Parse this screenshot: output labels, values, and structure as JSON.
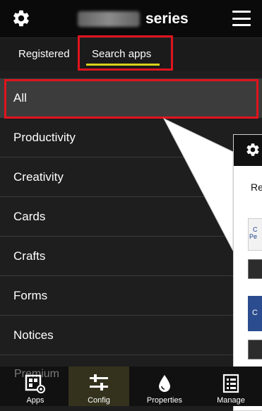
{
  "header": {
    "title_suffix": "series",
    "icons": {
      "settings": "gear-icon",
      "menu": "hamburger-menu-icon"
    }
  },
  "tabs": [
    {
      "label": "Registered",
      "active": false
    },
    {
      "label": "Search apps",
      "active": true
    }
  ],
  "categories": [
    {
      "label": "All",
      "selected": true
    },
    {
      "label": "Productivity"
    },
    {
      "label": "Creativity"
    },
    {
      "label": "Cards"
    },
    {
      "label": "Crafts"
    },
    {
      "label": "Forms"
    },
    {
      "label": "Notices"
    }
  ],
  "premium_partial": "Premium",
  "inset": {
    "tab_partial": "Re",
    "card_text_1": "C",
    "card_text_2": "Pe",
    "card_text_3": "C"
  },
  "bottom_nav": [
    {
      "label": "Apps",
      "icon": "apps-icon"
    },
    {
      "label": "Config",
      "icon": "sliders-icon",
      "active": true
    },
    {
      "label": "Properties",
      "icon": "ink-drop-icon"
    },
    {
      "label": "Manage",
      "icon": "manage-icon"
    }
  ],
  "colors": {
    "highlight_red": "#e0141e",
    "underline_yellow": "#d9d21a",
    "header_bg": "#0a0a0a",
    "list_bg": "#1e1e1e"
  }
}
